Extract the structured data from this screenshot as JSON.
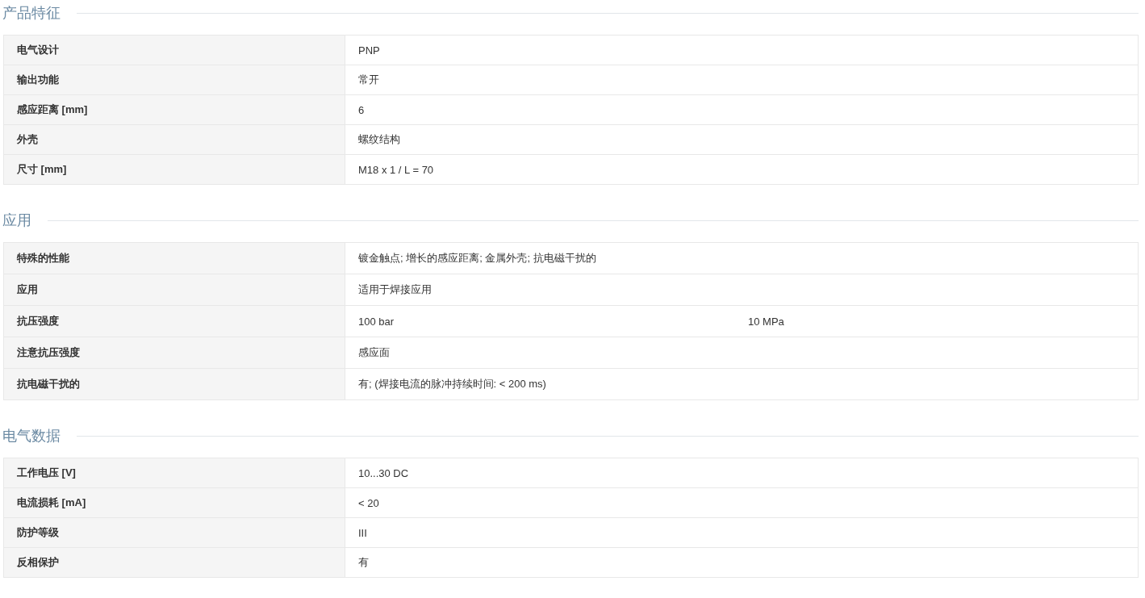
{
  "sections": [
    {
      "title": "产品特征",
      "rows": [
        {
          "label": "电气设计",
          "values": [
            "PNP"
          ]
        },
        {
          "label": "输出功能",
          "values": [
            "常开"
          ]
        },
        {
          "label": "感应距离 [mm]",
          "values": [
            "6"
          ]
        },
        {
          "label": "外壳",
          "values": [
            "螺纹结构"
          ]
        },
        {
          "label": "尺寸 [mm]",
          "values": [
            "M18 x 1 / L = 70"
          ]
        }
      ]
    },
    {
      "title": "应用",
      "rows": [
        {
          "label": "特殊的性能",
          "values": [
            "镀金触点; 增长的感应距离; 金属外壳; 抗电磁干扰的"
          ]
        },
        {
          "label": "应用",
          "values": [
            "适用于焊接应用"
          ]
        },
        {
          "label": "抗压强度",
          "values": [
            "100 bar",
            "10 MPa"
          ]
        },
        {
          "label": "注意抗压强度",
          "values": [
            "感应面"
          ]
        },
        {
          "label": "抗电磁干扰的",
          "values": [
            "有; (焊接电流的脉冲持续时间: < 200 ms)"
          ]
        }
      ]
    },
    {
      "title": "电气数据",
      "rows": [
        {
          "label": "工作电压 [V]",
          "values": [
            "10...30 DC"
          ]
        },
        {
          "label": "电流损耗 [mA]",
          "values": [
            "< 20"
          ]
        },
        {
          "label": "防护等级",
          "values": [
            "III"
          ]
        },
        {
          "label": "反相保护",
          "values": [
            "有"
          ]
        }
      ]
    }
  ]
}
